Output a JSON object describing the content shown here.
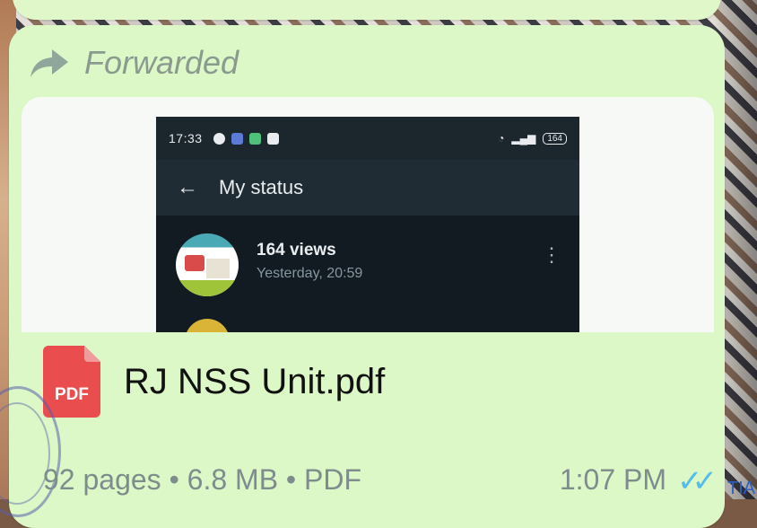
{
  "message": {
    "forwarded_label": "Forwarded",
    "file_name": "RJ NSS Unit.pdf",
    "file_type_badge": "PDF",
    "meta": "92 pages • 6.8 MB • PDF",
    "time": "1:07 PM",
    "read_ticks": "✓✓",
    "colors": {
      "bubble": "#dcf8c6",
      "pdf": "#e94d4d",
      "read_tick": "#53bdeb"
    }
  },
  "preview": {
    "status_time": "17:33",
    "battery": "164",
    "title": "My status",
    "back_glyph": "←",
    "views": "164 views",
    "when": "Yesterday, 20:59",
    "menu_glyph": "⋮"
  },
  "corner_text": "TIA"
}
